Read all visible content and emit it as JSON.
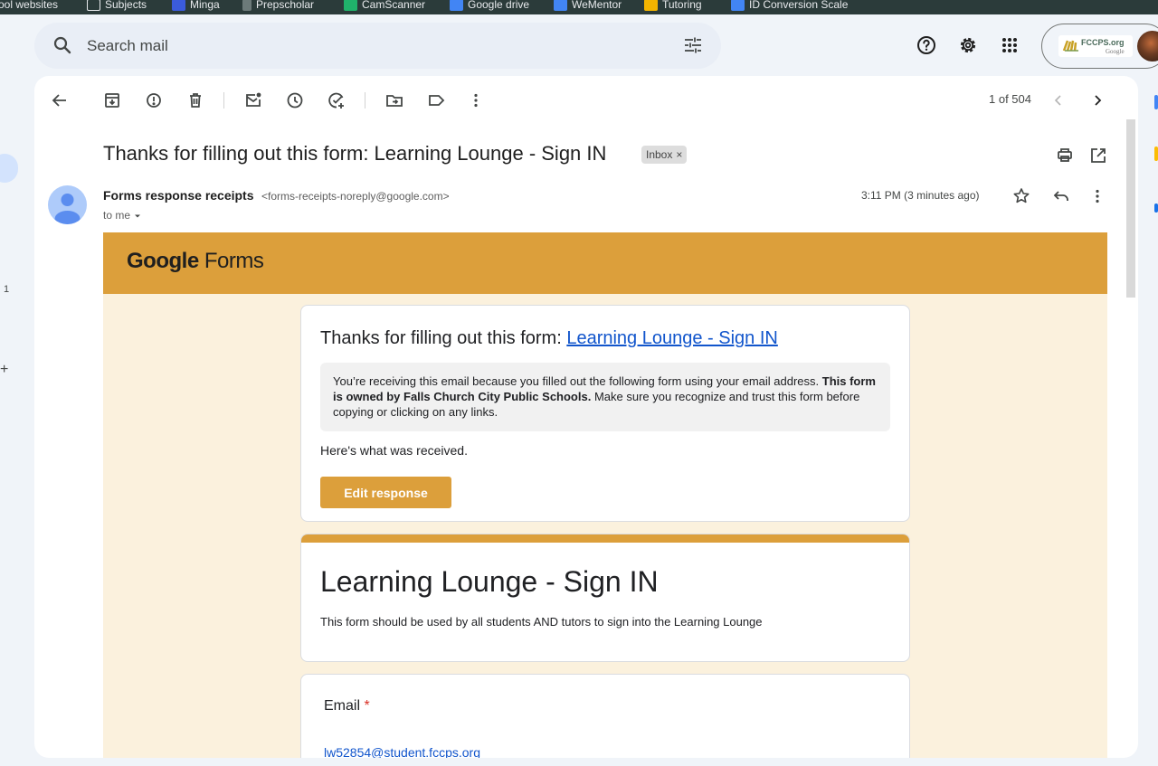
{
  "bookmarks": [
    {
      "label": "ool websites",
      "icon": "folder-icon",
      "color": "#2b3b3a"
    },
    {
      "label": "Subjects",
      "icon": "folder-icon",
      "color": "#2b3b3a"
    },
    {
      "label": "Minga",
      "icon": "minga-icon",
      "color": "#3b5bdb"
    },
    {
      "label": "Prepscholar",
      "icon": "prepscholar-icon",
      "color": "#2b3b3a"
    },
    {
      "label": "CamScanner",
      "icon": "camscanner-icon",
      "color": "#20b26b"
    },
    {
      "label": "Google drive",
      "icon": "drive-icon",
      "color": "#4285f4"
    },
    {
      "label": "WeMentor",
      "icon": "wementor-icon",
      "color": "#4285f4"
    },
    {
      "label": "Tutoring",
      "icon": "tutoring-icon",
      "color": "#f4b400"
    },
    {
      "label": "ID Conversion Scale",
      "icon": "docs-icon",
      "color": "#4285f4"
    }
  ],
  "search": {
    "placeholder": "Search mail"
  },
  "account": {
    "org_name": "FCCPS.org",
    "org_sub": "Google"
  },
  "rail": {
    "count": "1",
    "plus": "+"
  },
  "toolbar": {
    "pager": "1 of 504"
  },
  "email": {
    "subject": "Thanks for filling out this form: Learning Lounge - Sign IN",
    "label_chip": "Inbox",
    "chip_close": "×",
    "sender_name": "Forms response receipts",
    "sender_email": "<forms-receipts-noreply@google.com>",
    "to": "to me",
    "time": "3:11 PM (3 minutes ago)"
  },
  "body": {
    "brand_google": "Google",
    "brand_forms": "Forms",
    "card_title_prefix": "Thanks for filling out this form: ",
    "card_title_link": "Learning Lounge - Sign IN",
    "notice_1": "You’re receiving this email because you filled out the following form using your email address. ",
    "notice_bold": "This form is owned by Falls Church City Public Schools.",
    "notice_2": " Make sure you recognize and trust this form before copying or clicking on any links.",
    "received": "Here's what was received.",
    "edit_button": "Edit response",
    "form_title": "Learning Lounge - Sign IN",
    "form_description": "This form should be used by all students AND tutors to sign into the Learning Lounge",
    "question_label": "Email",
    "required_mark": "*",
    "answer": "lw52854@student.fccps.org"
  },
  "colors": {
    "forms_accent": "#dc9f3b",
    "forms_background": "#fbf1dd",
    "link": "#1155cc"
  }
}
